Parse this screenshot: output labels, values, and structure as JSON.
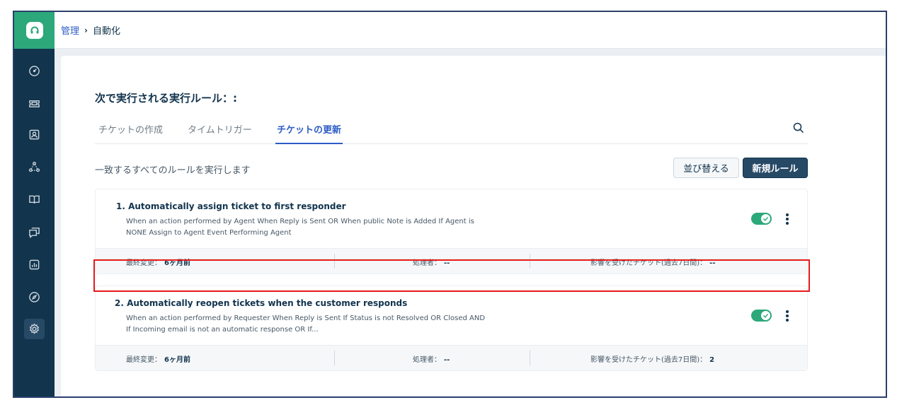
{
  "breadcrumb": {
    "parent": "管理",
    "separator": "›",
    "current": "自動化"
  },
  "sidebar": {
    "logo_icon": "headset-icon",
    "items": [
      {
        "icon": "dashboard-icon"
      },
      {
        "icon": "ticket-icon"
      },
      {
        "icon": "contacts-icon"
      },
      {
        "icon": "social-icon"
      },
      {
        "icon": "solutions-book-icon"
      },
      {
        "icon": "forums-icon"
      },
      {
        "icon": "reports-icon"
      },
      {
        "icon": "compass-icon"
      },
      {
        "icon": "admin-gear-icon",
        "active": true
      }
    ]
  },
  "page": {
    "title": "次で実行される実行ルール：:",
    "tabs": [
      {
        "label": "チケットの作成",
        "active": false
      },
      {
        "label": "タイムトリガー",
        "active": false
      },
      {
        "label": "チケットの更新",
        "active": true
      }
    ],
    "subtitle": "一致するすべてのルールを実行します",
    "sort_button": "並び替える",
    "new_rule_button": "新規ルール"
  },
  "rules": [
    {
      "title": "1. Automatically assign ticket to first responder",
      "description_line1": "When an action performed by Agent When Reply is Sent OR When public Note is Added If Agent is",
      "description_line2": "NONE Assign to Agent Event Performing Agent",
      "enabled": true,
      "last_modified_label": "最終変更：",
      "last_modified_value": "6ヶ月前",
      "processed_by_label": "処理者：",
      "processed_by_value": "--",
      "affected_label": "影響を受けたチケット(過去7日間)：",
      "affected_value": "--",
      "highlighted": true
    },
    {
      "title": "2. Automatically reopen tickets when the customer responds",
      "description_line1": "When an action performed by Requester When Reply is Sent If Status is not Resolved OR Closed AND",
      "description_line2": "If Incoming email is not an automatic response OR If...",
      "enabled": true,
      "last_modified_label": "最終変更：",
      "last_modified_value": "6ヶ月前",
      "processed_by_label": "処理者：",
      "processed_by_value": "--",
      "affected_label": "影響を受けたチケット(過去7日間)：",
      "affected_value": "2",
      "highlighted": false
    }
  ],
  "colors": {
    "sidebar": "#12344d",
    "logo": "#2ca87a",
    "accent": "#2c5cc5",
    "toggle_on": "#2ca87a",
    "highlight": "#e51a1a"
  }
}
